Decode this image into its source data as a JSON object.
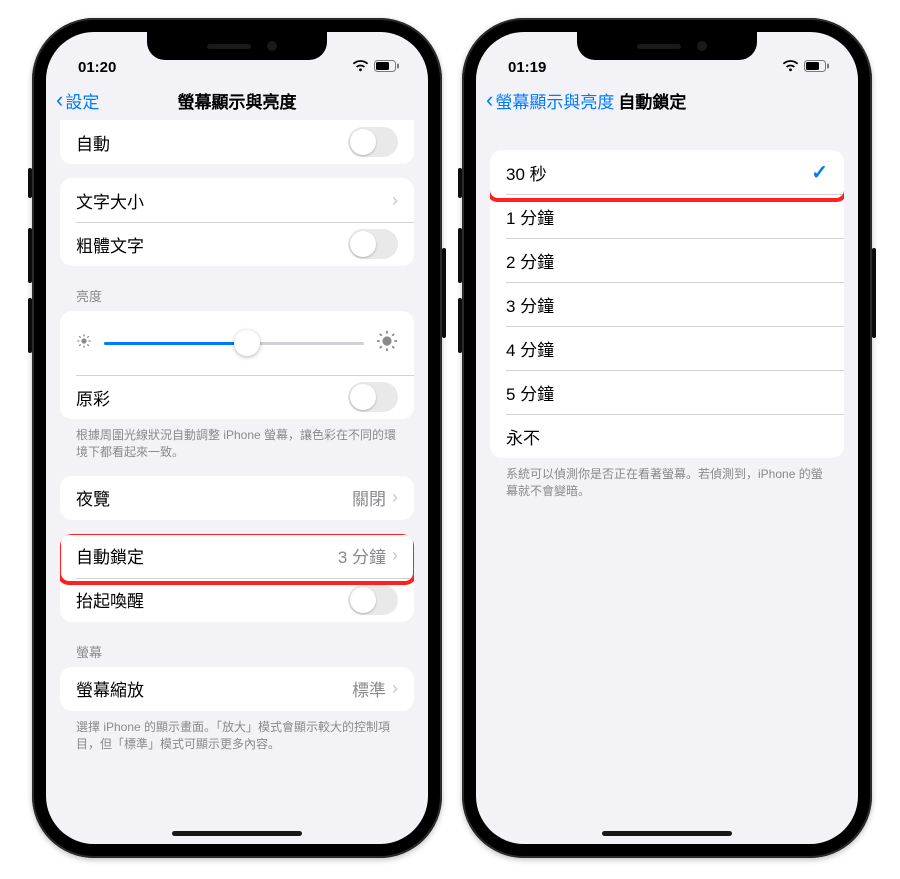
{
  "phone_left": {
    "status": {
      "time": "01:20"
    },
    "nav": {
      "back": "設定",
      "title": "螢幕顯示與亮度"
    },
    "rows": {
      "auto": "自動",
      "text_size": "文字大小",
      "bold_text": "粗體文字",
      "brightness_header": "亮度",
      "true_tone": "原彩",
      "true_tone_footer": "根據周圍光線狀況自動調整 iPhone 螢幕，讓色彩在不同的環境下都看起來一致。",
      "night_shift": "夜覽",
      "night_shift_value": "關閉",
      "auto_lock": "自動鎖定",
      "auto_lock_value": "3 分鐘",
      "raise_to_wake": "抬起喚醒",
      "screen_header": "螢幕",
      "display_zoom": "螢幕縮放",
      "display_zoom_value": "標準",
      "display_zoom_footer": "選擇 iPhone 的顯示畫面。「放大」模式會顯示較大的控制項目，但「標準」模式可顯示更多內容。"
    }
  },
  "phone_right": {
    "status": {
      "time": "01:19"
    },
    "nav": {
      "back": "螢幕顯示與亮度",
      "title": "自動鎖定"
    },
    "options": [
      {
        "label": "30 秒",
        "selected": true
      },
      {
        "label": "1 分鐘",
        "selected": false
      },
      {
        "label": "2 分鐘",
        "selected": false
      },
      {
        "label": "3 分鐘",
        "selected": false
      },
      {
        "label": "4 分鐘",
        "selected": false
      },
      {
        "label": "5 分鐘",
        "selected": false
      },
      {
        "label": "永不",
        "selected": false
      }
    ],
    "footer": "系統可以偵測你是否正在看著螢幕。若偵測到，iPhone 的螢幕就不會變暗。"
  }
}
